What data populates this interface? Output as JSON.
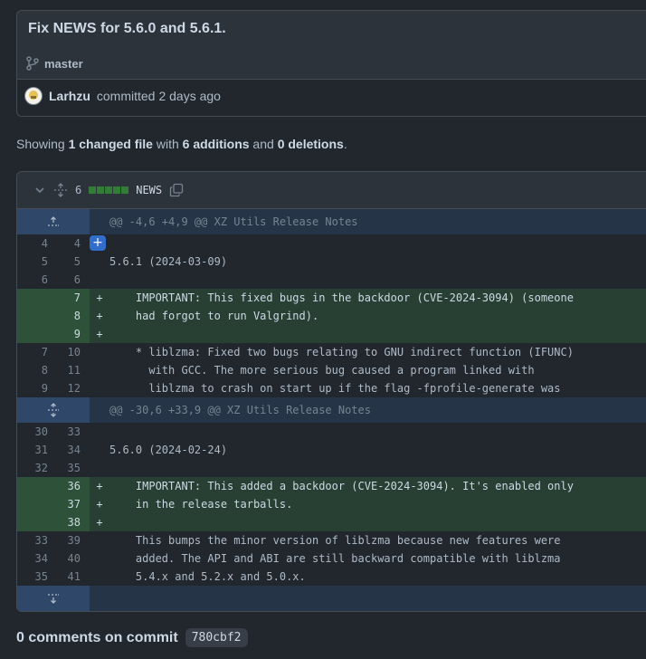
{
  "commit": {
    "title": "Fix NEWS for 5.6.0 and 5.6.1.",
    "branch": "master",
    "author": "Larhzu",
    "action": "committed",
    "time": "2 days ago"
  },
  "summary": {
    "prefix": "Showing ",
    "files": "1 changed file",
    "with": " with ",
    "additions": "6 additions",
    "and": " and ",
    "deletions": "0 deletions",
    "suffix": "."
  },
  "file": {
    "count": "6",
    "name": "NEWS"
  },
  "hunks": [
    {
      "header": "@@ -4,6 +4,9 @@ XZ Utils Release Notes",
      "lines": [
        {
          "type": "ctx",
          "old": "4",
          "new": "4",
          "text": ""
        },
        {
          "type": "ctx",
          "old": "5",
          "new": "5",
          "text": "5.6.1 (2024-03-09)"
        },
        {
          "type": "ctx",
          "old": "6",
          "new": "6",
          "text": ""
        },
        {
          "type": "add",
          "old": "",
          "new": "7",
          "text": "    IMPORTANT: This fixed bugs in the backdoor (CVE-2024-3094) (someone"
        },
        {
          "type": "add",
          "old": "",
          "new": "8",
          "text": "    had forgot to run Valgrind)."
        },
        {
          "type": "add",
          "old": "",
          "new": "9",
          "text": ""
        },
        {
          "type": "ctx",
          "old": "7",
          "new": "10",
          "text": "    * liblzma: Fixed two bugs relating to GNU indirect function (IFUNC)"
        },
        {
          "type": "ctx",
          "old": "8",
          "new": "11",
          "text": "      with GCC. The more serious bug caused a program linked with"
        },
        {
          "type": "ctx",
          "old": "9",
          "new": "12",
          "text": "      liblzma to crash on start up if the flag -fprofile-generate was"
        }
      ]
    },
    {
      "header": "@@ -30,6 +33,9 @@ XZ Utils Release Notes",
      "lines": [
        {
          "type": "ctx",
          "old": "30",
          "new": "33",
          "text": ""
        },
        {
          "type": "ctx",
          "old": "31",
          "new": "34",
          "text": "5.6.0 (2024-02-24)"
        },
        {
          "type": "ctx",
          "old": "32",
          "new": "35",
          "text": ""
        },
        {
          "type": "add",
          "old": "",
          "new": "36",
          "text": "    IMPORTANT: This added a backdoor (CVE-2024-3094). It's enabled only"
        },
        {
          "type": "add",
          "old": "",
          "new": "37",
          "text": "    in the release tarballs."
        },
        {
          "type": "add",
          "old": "",
          "new": "38",
          "text": ""
        },
        {
          "type": "ctx",
          "old": "33",
          "new": "39",
          "text": "    This bumps the minor version of liblzma because new features were"
        },
        {
          "type": "ctx",
          "old": "34",
          "new": "40",
          "text": "    added. The API and ABI are still backward compatible with liblzma"
        },
        {
          "type": "ctx",
          "old": "35",
          "new": "41",
          "text": "    5.4.x and 5.2.x and 5.0.x."
        }
      ]
    }
  ],
  "comments": {
    "text": "0 comments on commit",
    "sha": "780cbf2"
  }
}
